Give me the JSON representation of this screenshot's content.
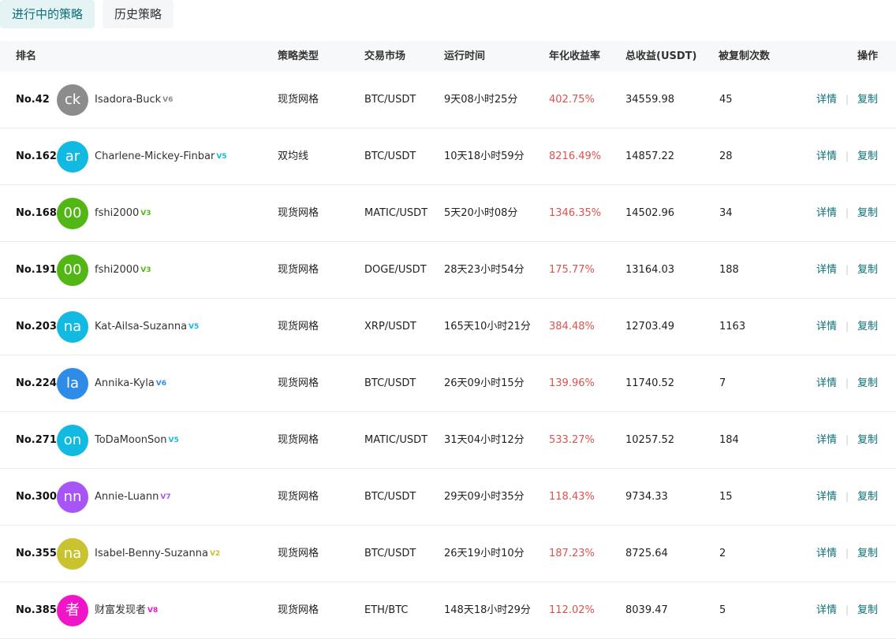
{
  "tabs": [
    "进行中的策略",
    "历史策略"
  ],
  "columns": {
    "rank": "排名",
    "type": "策略类型",
    "market": "交易市场",
    "runtime": "运行时间",
    "annual": "年化收益率",
    "total": "总收益(USDT)",
    "copies": "被复制次数",
    "action": "操作"
  },
  "actions": {
    "detail": "详情",
    "copy": "复制",
    "separator": "|"
  },
  "colors": {
    "accent": "#0a6e76",
    "rate": "#d9534f"
  },
  "rows": [
    {
      "rank": "No.42",
      "avatar": "ck",
      "avatar_color": "#8c8c8c",
      "name": "Isadora-Buck",
      "badge": "V6",
      "badge_color": "#8c8c8c",
      "type": "现货网格",
      "market": "BTC/USDT",
      "runtime": "9天08小时25分",
      "annual": "402.75%",
      "total": "34559.98",
      "copies": "45"
    },
    {
      "rank": "No.162",
      "avatar": "ar",
      "avatar_color": "#12b9e0",
      "name": "Charlene-Mickey-Finbar",
      "badge": "V5",
      "badge_color": "#12b9e0",
      "type": "双均线",
      "market": "BTC/USDT",
      "runtime": "10天18小时59分",
      "annual": "8216.49%",
      "total": "14857.22",
      "copies": "28"
    },
    {
      "rank": "No.168",
      "avatar": "00",
      "avatar_color": "#52b614",
      "name": "fshi2000",
      "badge": "V3",
      "badge_color": "#52b614",
      "type": "现货网格",
      "market": "MATIC/USDT",
      "runtime": "5天20小时08分",
      "annual": "1346.35%",
      "total": "14502.96",
      "copies": "34"
    },
    {
      "rank": "No.191",
      "avatar": "00",
      "avatar_color": "#52b614",
      "name": "fshi2000",
      "badge": "V3",
      "badge_color": "#52b614",
      "type": "现货网格",
      "market": "DOGE/USDT",
      "runtime": "28天23小时54分",
      "annual": "175.77%",
      "total": "13164.03",
      "copies": "188"
    },
    {
      "rank": "No.203",
      "avatar": "na",
      "avatar_color": "#12b9e0",
      "name": "Kat-Ailsa-Suzanna",
      "badge": "V5",
      "badge_color": "#12b9e0",
      "type": "现货网格",
      "market": "XRP/USDT",
      "runtime": "165天10小时21分",
      "annual": "384.48%",
      "total": "12703.49",
      "copies": "1163"
    },
    {
      "rank": "No.224",
      "avatar": "la",
      "avatar_color": "#2e8be6",
      "name": "Annika-Kyla",
      "badge": "V6",
      "badge_color": "#2e8be6",
      "type": "现货网格",
      "market": "BTC/USDT",
      "runtime": "26天09小时15分",
      "annual": "139.96%",
      "total": "11740.52",
      "copies": "7"
    },
    {
      "rank": "No.271",
      "avatar": "on",
      "avatar_color": "#12b9e0",
      "name": "ToDaMoonSon",
      "badge": "V5",
      "badge_color": "#12b9e0",
      "type": "现货网格",
      "market": "MATIC/USDT",
      "runtime": "31天04小时12分",
      "annual": "533.27%",
      "total": "10257.52",
      "copies": "184"
    },
    {
      "rank": "No.300",
      "avatar": "nn",
      "avatar_color": "#a855f7",
      "name": "Annie-Luann",
      "badge": "V7",
      "badge_color": "#a855f7",
      "type": "现货网格",
      "market": "BTC/USDT",
      "runtime": "29天09小时35分",
      "annual": "118.43%",
      "total": "9734.33",
      "copies": "15"
    },
    {
      "rank": "No.355",
      "avatar": "na",
      "avatar_color": "#c8c32e",
      "name": "Isabel-Benny-Suzanna",
      "badge": "V2",
      "badge_color": "#c8c32e",
      "type": "现货网格",
      "market": "BTC/USDT",
      "runtime": "26天19小时10分",
      "annual": "187.23%",
      "total": "8725.64",
      "copies": "2"
    },
    {
      "rank": "No.385",
      "avatar": "者",
      "avatar_color": "#f016c8",
      "name": "财富发现者",
      "badge": "V8",
      "badge_color": "#f016c8",
      "type": "现货网格",
      "market": "ETH/BTC",
      "runtime": "148天18小时29分",
      "annual": "112.02%",
      "total": "8039.47",
      "copies": "5"
    }
  ]
}
